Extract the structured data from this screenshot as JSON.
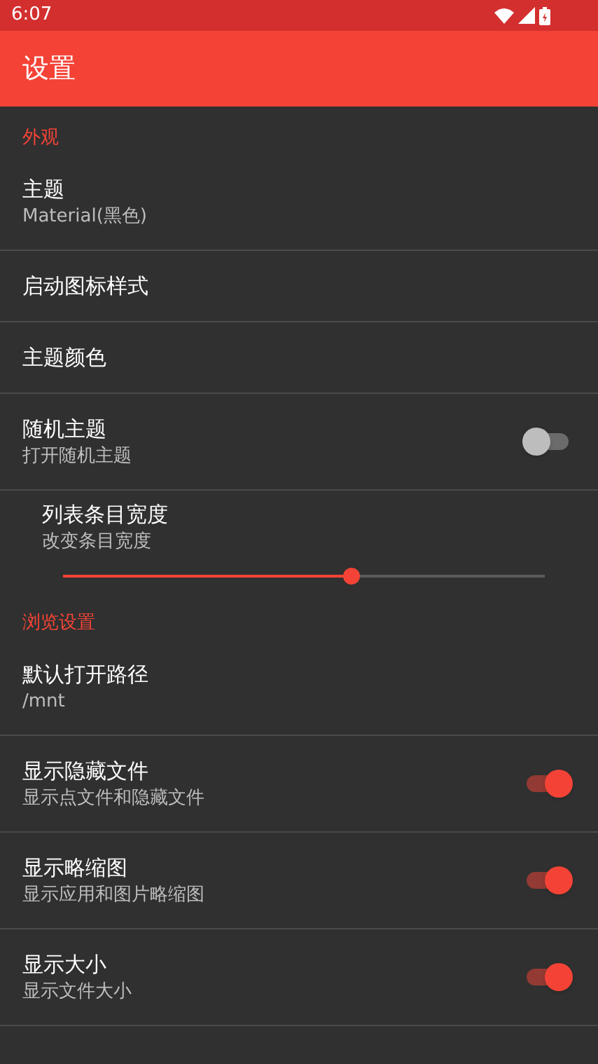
{
  "status_bar": {
    "time": "6:07"
  },
  "app_bar": {
    "title": "设置"
  },
  "sections": [
    {
      "title": "外观",
      "items": [
        {
          "kind": "pref",
          "title": "主题",
          "summary": "Material(黑色)"
        },
        {
          "kind": "pref",
          "title": "启动图标样式"
        },
        {
          "kind": "pref",
          "title": "主题颜色"
        },
        {
          "kind": "switch",
          "title": "随机主题",
          "summary": "打开随机主题",
          "on": false
        },
        {
          "kind": "slider",
          "title": "列表条目宽度",
          "summary": "改变条目宽度",
          "level": 0.6
        }
      ]
    },
    {
      "title": "浏览设置",
      "items": [
        {
          "kind": "pref",
          "title": "默认打开路径",
          "summary": "/mnt"
        },
        {
          "kind": "switch",
          "title": "显示隐藏文件",
          "summary": "显示点文件和隐藏文件",
          "on": true
        },
        {
          "kind": "switch",
          "title": "显示略缩图",
          "summary": "显示应用和图片略缩图",
          "on": true
        },
        {
          "kind": "switch",
          "title": "显示大小",
          "summary": "显示文件大小",
          "on": true
        }
      ]
    }
  ]
}
